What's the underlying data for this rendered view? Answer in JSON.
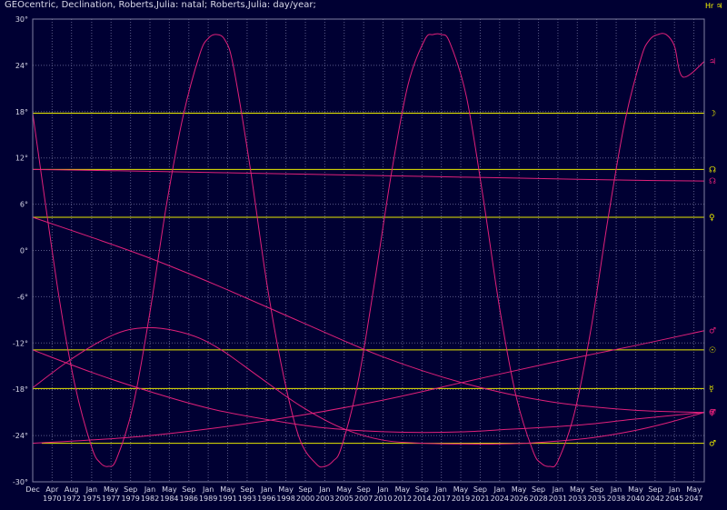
{
  "header": {
    "title": "GEOcentric, Declination, Roberts,Julia: natal; Roberts,Julia: day/year;",
    "corner_label": "Hr ♃"
  },
  "colors": {
    "background": "#000033",
    "grid": "#5a5a8a",
    "natal_line": "#e8e800",
    "transit_curve": "#e0207a",
    "label": "#d8d8e8"
  },
  "chart_data": {
    "type": "line",
    "title": "GEOcentric, Declination, Roberts,Julia: natal; Roberts,Julia: day/year;",
    "xlabel": "",
    "ylabel": "",
    "xlim": [
      1967.92,
      2048.58
    ],
    "ylim": [
      -30,
      30
    ],
    "grid": true,
    "y_ticks": [
      30,
      24,
      18,
      12,
      6,
      0,
      -6,
      -12,
      -18,
      -24,
      -30
    ],
    "y_tick_labels": [
      "30°",
      "24°",
      "18°",
      "12°",
      "6°",
      "0°",
      "-6°",
      "-12°",
      "-18°",
      "-24°",
      "-30°"
    ],
    "x_ticks": [
      {
        "year": 1967.92,
        "month": "Dec",
        "label": ""
      },
      {
        "year": 1970.25,
        "month": "Apr",
        "label": "1970"
      },
      {
        "year": 1972.58,
        "month": "Aug",
        "label": "1972"
      },
      {
        "year": 1975.0,
        "month": "Jan",
        "label": "1975"
      },
      {
        "year": 1977.33,
        "month": "May",
        "label": "1977"
      },
      {
        "year": 1979.67,
        "month": "Sep",
        "label": "1979"
      },
      {
        "year": 1982.0,
        "month": "Jan",
        "label": "1982"
      },
      {
        "year": 1984.33,
        "month": "May",
        "label": "1984"
      },
      {
        "year": 1986.67,
        "month": "Sep",
        "label": "1986"
      },
      {
        "year": 1989.0,
        "month": "Jan",
        "label": "1989"
      },
      {
        "year": 1991.33,
        "month": "May",
        "label": "1991"
      },
      {
        "year": 1993.67,
        "month": "Sep",
        "label": "1993"
      },
      {
        "year": 1996.0,
        "month": "Jan",
        "label": "1996"
      },
      {
        "year": 1998.33,
        "month": "May",
        "label": "1998"
      },
      {
        "year": 2000.67,
        "month": "Sep",
        "label": "2000"
      },
      {
        "year": 2003.0,
        "month": "Jan",
        "label": "2003"
      },
      {
        "year": 2005.33,
        "month": "May",
        "label": "2005"
      },
      {
        "year": 2007.67,
        "month": "Sep",
        "label": "2007"
      },
      {
        "year": 2010.0,
        "month": "Jan",
        "label": "2010"
      },
      {
        "year": 2012.33,
        "month": "May",
        "label": "2012"
      },
      {
        "year": 2014.67,
        "month": "Sep",
        "label": "2014"
      },
      {
        "year": 2017.0,
        "month": "Jan",
        "label": "2017"
      },
      {
        "year": 2019.33,
        "month": "May",
        "label": "2019"
      },
      {
        "year": 2021.67,
        "month": "Sep",
        "label": "2021"
      },
      {
        "year": 2024.0,
        "month": "Jan",
        "label": "2024"
      },
      {
        "year": 2026.33,
        "month": "May",
        "label": "2026"
      },
      {
        "year": 2028.67,
        "month": "Sep",
        "label": "2028"
      },
      {
        "year": 2031.0,
        "month": "Jan",
        "label": "2031"
      },
      {
        "year": 2033.33,
        "month": "May",
        "label": "2033"
      },
      {
        "year": 2035.67,
        "month": "Sep",
        "label": "2035"
      },
      {
        "year": 2038.0,
        "month": "Jan",
        "label": "2038"
      },
      {
        "year": 2040.33,
        "month": "May",
        "label": "2040"
      },
      {
        "year": 2042.67,
        "month": "Sep",
        "label": "2042"
      },
      {
        "year": 2045.0,
        "month": "Jan",
        "label": "2045"
      },
      {
        "year": 2047.33,
        "month": "May",
        "label": "2047"
      }
    ],
    "natal_lines": [
      {
        "glyph": "☽",
        "y": 17.8
      },
      {
        "glyph": "☊",
        "y": 10.5
      },
      {
        "glyph": "♀",
        "y": 4.3
      },
      {
        "glyph": "☉",
        "y": -12.9
      },
      {
        "glyph": "☿",
        "y": -17.9
      },
      {
        "glyph": "♂",
        "y": -25.0,
        "x_start": 1969.0
      }
    ],
    "series": [
      {
        "glyph": "♃",
        "x": [
          1967.92,
          1971.0,
          1973.0,
          1975.0,
          1976.0,
          1977.0,
          1978.0,
          1980.0,
          1982.0,
          1984.0,
          1986.0,
          1988.0,
          1989.0,
          1990.0,
          1991.0,
          1992.0,
          1994.0,
          1996.0,
          1998.0,
          2000.0,
          2002.0,
          2003.0,
          2004.0,
          2005.0,
          2007.0,
          2009.0,
          2011.0,
          2013.0,
          2015.0,
          2016.0,
          2017.0,
          2018.0,
          2020.0,
          2022.0,
          2024.0,
          2026.0,
          2028.0,
          2029.0,
          2030.0,
          2031.0,
          2033.0,
          2035.0,
          2037.0,
          2039.0,
          2041.0,
          2042.0,
          2043.0,
          2044.0,
          2045.0,
          2046.0,
          2048.58
        ],
        "y": [
          17.8,
          -5.5,
          -17.5,
          -25.5,
          -27.5,
          -28.0,
          -27.0,
          -20.0,
          -8.0,
          6.0,
          17.5,
          25.5,
          27.5,
          28.0,
          27.3,
          24.0,
          11.0,
          -4.0,
          -16.0,
          -24.5,
          -27.7,
          -28.0,
          -27.3,
          -25.5,
          -17.0,
          -4.0,
          10.0,
          21.5,
          27.3,
          28.0,
          28.0,
          27.0,
          20.0,
          7.0,
          -7.5,
          -19.0,
          -26.0,
          -27.6,
          -28.0,
          -27.3,
          -21.0,
          -10.0,
          4.0,
          16.5,
          25.0,
          27.3,
          28.0,
          28.0,
          26.5,
          22.5,
          24.5
        ]
      },
      {
        "glyph": "☊",
        "x": [
          1967.92,
          1980.0,
          1990.0,
          2000.0,
          2010.0,
          2020.0,
          2030.0,
          2040.0,
          2048.58
        ],
        "y": [
          10.5,
          10.3,
          10.1,
          9.9,
          9.7,
          9.5,
          9.3,
          9.1,
          9.0
        ]
      },
      {
        "glyph": "♀",
        "x": [
          1967.92,
          1975.0,
          1982.0,
          1990.0,
          2000.0,
          2010.0,
          2020.0,
          2030.0,
          2040.0,
          2048.58
        ],
        "y": [
          4.3,
          1.7,
          -1.0,
          -4.5,
          -9.2,
          -13.8,
          -17.3,
          -19.6,
          -20.7,
          -21.0
        ]
      },
      {
        "glyph": "☉",
        "x": [
          1967.92,
          1975.0,
          1982.0,
          1990.0,
          2000.0,
          2005.0,
          2010.0,
          2015.0,
          2020.0,
          2025.0,
          2030.0,
          2035.0,
          2040.0,
          2048.58
        ],
        "y": [
          -12.9,
          -15.8,
          -18.3,
          -20.7,
          -22.6,
          -23.2,
          -23.5,
          -23.6,
          -23.5,
          -23.2,
          -22.9,
          -22.5,
          -21.9,
          -21.0
        ]
      },
      {
        "glyph": "♂",
        "x": [
          1967.92,
          1972.0,
          1976.0,
          1979.0,
          1982.0,
          1985.0,
          1988.0,
          1991.0,
          1995.0,
          2000.0,
          2005.0,
          2010.0,
          2015.0,
          2020.0,
          2024.0,
          2027.0,
          2030.0,
          2035.0,
          2040.0,
          2044.0,
          2048.58
        ],
        "y": [
          -17.8,
          -14.5,
          -11.8,
          -10.4,
          -10.0,
          -10.4,
          -11.4,
          -13.2,
          -16.3,
          -20.1,
          -23.0,
          -24.6,
          -25.0,
          -25.1,
          -25.1,
          -25.0,
          -24.8,
          -24.3,
          -23.4,
          -22.4,
          -21.0
        ]
      },
      {
        "glyph": "♂",
        "x": [
          1967.92,
          1980.0,
          1990.0,
          2000.0,
          2010.0,
          2020.0,
          2030.0,
          2040.0,
          2048.58
        ],
        "y": [
          -25.0,
          -24.2,
          -23.0,
          -21.4,
          -19.4,
          -17.0,
          -14.6,
          -12.4,
          -10.4
        ]
      }
    ]
  }
}
